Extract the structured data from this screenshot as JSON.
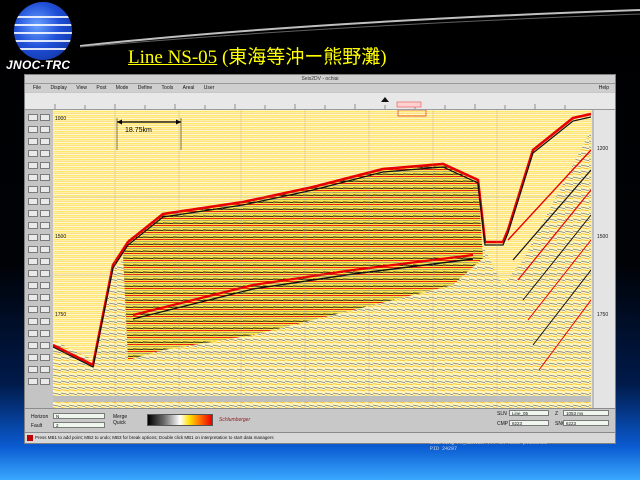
{
  "branding": {
    "logo_text": "JNOC-TRC"
  },
  "slide": {
    "title_line": "Line NS-05",
    "title_rest": " (東海等沖ー熊野灘)"
  },
  "window": {
    "title": "Seis2DV - ochiai",
    "menu": [
      "File",
      "Display",
      "View",
      "Post",
      "Mode",
      "Define",
      "Tools",
      "Areal",
      "User"
    ],
    "help": "Help"
  },
  "section": {
    "scale_annotation": "18.75km",
    "time_labels": [
      "1000",
      "1500",
      "1750"
    ],
    "right_time_labels": [
      "1200",
      "1500",
      "1750"
    ],
    "colors": {
      "positive": "#e80000",
      "negative": "#000000",
      "mid": "#ffe000",
      "background": "#ffffff"
    }
  },
  "bottom_panel": {
    "horizon_label": "Horizon",
    "fault_label": "Fault",
    "horizon_value": "N",
    "fault_value": "2",
    "merge_label": "Merge",
    "quick_label": "Quick",
    "vendor": "Schlumberger",
    "readouts": [
      {
        "label": "SLN",
        "value": "Line_05"
      },
      {
        "label": "Z",
        "value": "1053 ms"
      },
      {
        "label": "CMP",
        "value": "6223"
      },
      {
        "label": "SNC",
        "value": "6223"
      }
    ]
  },
  "status": {
    "message": "Press MB1 to add point; MB2 to undo; MB3 for break options; Double click MB1 on interpretation to start data managers",
    "overlay": "Starting PM_SERVER ... on host ptisun01\nPID 24297"
  }
}
